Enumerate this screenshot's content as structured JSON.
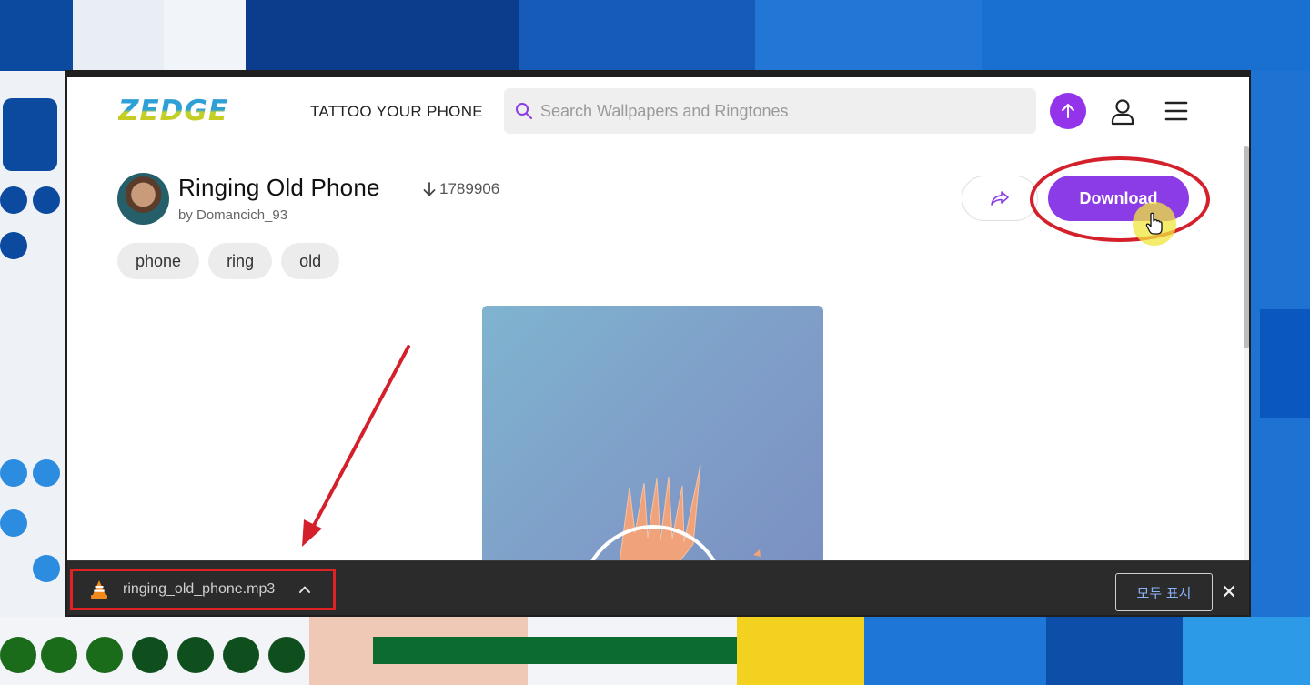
{
  "site": {
    "logo_text": "ZEDGE",
    "tagline": "TATTOO YOUR PHONE",
    "search_placeholder": "Search Wallpapers and Ringtones",
    "accent_color": "#8b3ce6"
  },
  "item": {
    "title": "Ringing Old Phone",
    "download_count": "1789906",
    "author": "by Domancich_93",
    "tags": [
      "phone",
      "ring",
      "old"
    ],
    "download_label": "Download"
  },
  "download_shelf": {
    "file_name": "ringing_old_phone.mp3",
    "show_all_label": "모두 표시"
  },
  "icons": {
    "search": "search-icon",
    "upload": "arrow-up-icon",
    "user": "user-icon",
    "menu": "hamburger-icon",
    "share": "share-icon",
    "download_count": "arrow-down-icon",
    "file_type": "vlc-cone-icon",
    "expand": "chevron-up-icon",
    "close": "close-icon"
  }
}
